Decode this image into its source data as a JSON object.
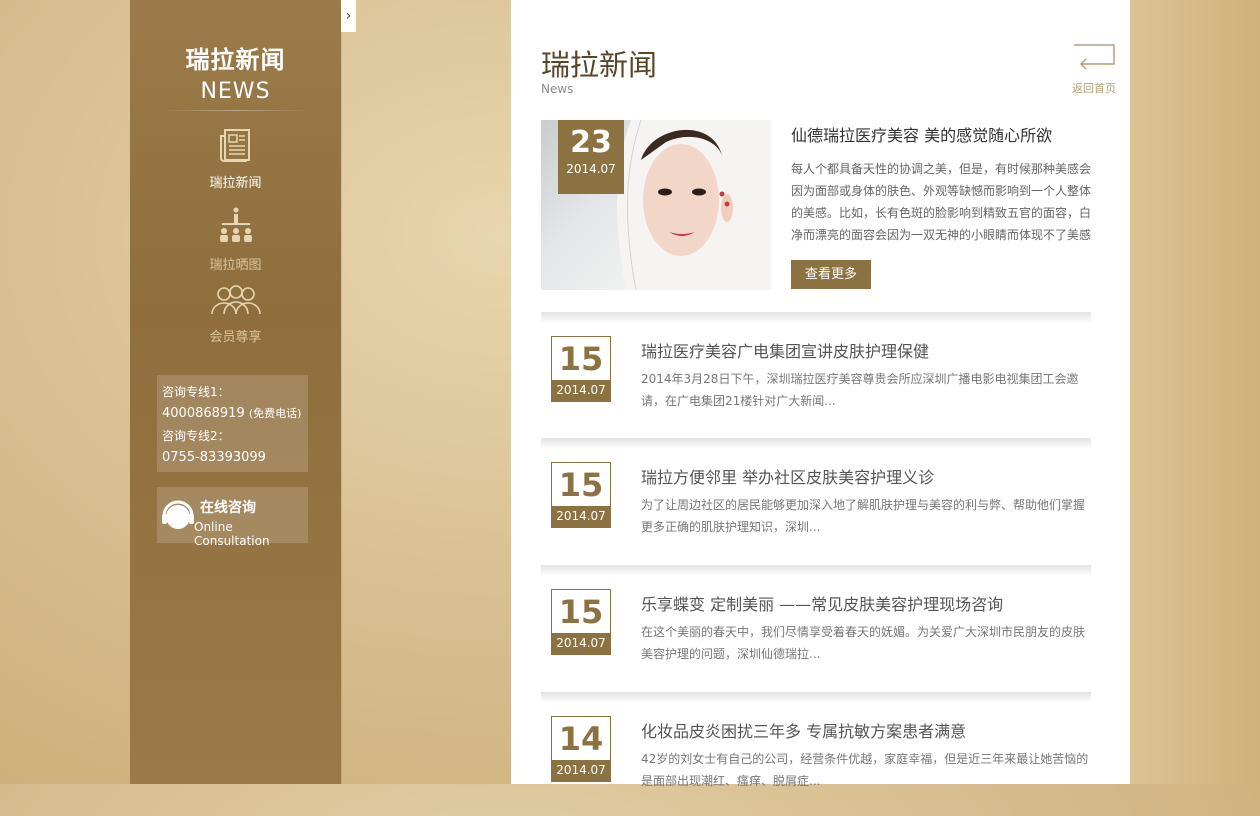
{
  "sidebar": {
    "title_cn": "瑞拉新闻",
    "title_en": "NEWS",
    "items": [
      {
        "label": "瑞拉新闻",
        "icon": "newspaper-icon"
      },
      {
        "label": "瑞拉晒图",
        "icon": "gallery-people-icon"
      },
      {
        "label": "会员尊享",
        "icon": "members-icon"
      }
    ],
    "hotline": {
      "line1_label": "咨询专线1：",
      "line1_number": "4000868919",
      "line1_note": "(免费电话)",
      "line2_label": "咨询专线2：",
      "line2_number": "0755-83393099"
    },
    "consult": {
      "label_cn": "在线咨询",
      "label_en": "Online Consultation",
      "icon": "headset-icon"
    },
    "toggle_icon": "chevron-right-icon"
  },
  "header": {
    "title": "瑞拉新闻",
    "subtitle": "News",
    "back_label": "返回首页",
    "back_icon": "return-arrow-icon"
  },
  "featured": {
    "day": "23",
    "ym": "2014.07",
    "title": "仙德瑞拉医疗美容 美的感觉随心所欲",
    "desc": "每人个都具备天性的协调之美，但是，有时候那种美感会因为面部或身体的肤色、外观等缺憾而影响到一个人整体的美感。比如，长有色斑的脸影响到精致五官的面容，白净而漂亮的面容会因为一双无神的小眼睛而体现不了美感",
    "more_label": "查看更多",
    "accent": "#8d7241"
  },
  "news": [
    {
      "day": "15",
      "ym": "2014.07",
      "title": "瑞拉医疗美容广电集团宣讲皮肤护理保健",
      "desc": "2014年3月28日下午，深圳瑞拉医疗美容尊贵会所应深圳广播电影电视集团工会邀请，在广电集团21楼针对广大新闻..."
    },
    {
      "day": "15",
      "ym": "2014.07",
      "title": "瑞拉方便邻里 举办社区皮肤美容护理义诊",
      "desc": "为了让周边社区的居民能够更加深入地了解肌肤护理与美容的利与弊、帮助他们掌握更多正确的肌肤护理知识，深圳..."
    },
    {
      "day": "15",
      "ym": "2014.07",
      "title": "乐享蝶变 定制美丽 ——常见皮肤美容护理现场咨询",
      "desc": "在这个美丽的春天中，我们尽情享受着春天的妩媚。为关爱广大深圳市民朋友的皮肤美容护理的问题，深圳仙德瑞拉..."
    },
    {
      "day": "14",
      "ym": "2014.07",
      "title": "化妆品皮炎困扰三年多 专属抗敏方案患者满意",
      "desc": "42岁的刘女士有自己的公司，经营条件优越，家庭幸福，但是近三年来最让她苦恼的是面部出现潮红、瘙痒、脱屑症..."
    }
  ]
}
